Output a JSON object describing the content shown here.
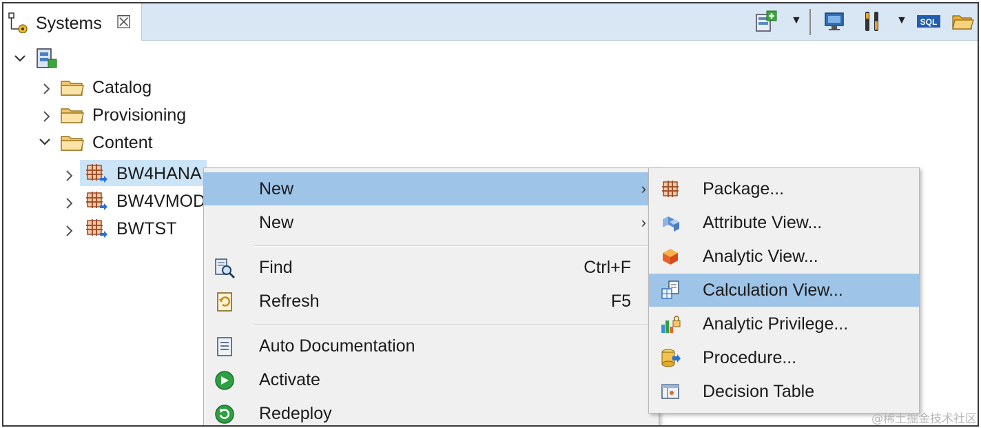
{
  "view": {
    "tab_title": "Systems",
    "close_glyph": "☒"
  },
  "toolbar": {
    "icons": [
      "add-system-icon",
      "dropdown-caret",
      "monitor-icon",
      "tools-icon",
      "dropdown-caret",
      "sql-icon",
      "open-folder-icon"
    ],
    "sql_text": "SQL"
  },
  "tree": {
    "root_label": "",
    "items": [
      {
        "label": "Catalog"
      },
      {
        "label": "Provisioning"
      },
      {
        "label": "Content"
      },
      {
        "label": "BW4HANA"
      },
      {
        "label": "BW4VMOD"
      },
      {
        "label": "BWTST"
      }
    ]
  },
  "context_menu": {
    "items": [
      {
        "label": "New",
        "accel": "",
        "arrow": "›"
      },
      {
        "label": "New",
        "accel": "",
        "arrow": "›"
      },
      {
        "label": "Find",
        "accel": "Ctrl+F"
      },
      {
        "label": "Refresh",
        "accel": "F5"
      },
      {
        "label": "Auto Documentation"
      },
      {
        "label": "Activate"
      },
      {
        "label": "Redeploy"
      }
    ]
  },
  "submenu": {
    "items": [
      {
        "label": "Package..."
      },
      {
        "label": "Attribute View..."
      },
      {
        "label": "Analytic View..."
      },
      {
        "label": "Calculation View..."
      },
      {
        "label": "Analytic Privilege..."
      },
      {
        "label": "Procedure..."
      },
      {
        "label": "Decision Table"
      }
    ]
  },
  "watermark": "@稀土掘金技术社区",
  "colors": {
    "highlight": "#9ec4e8",
    "selection": "#cce4f7",
    "tabbar": "#d9e6f4",
    "folder": "#f2c66b"
  }
}
